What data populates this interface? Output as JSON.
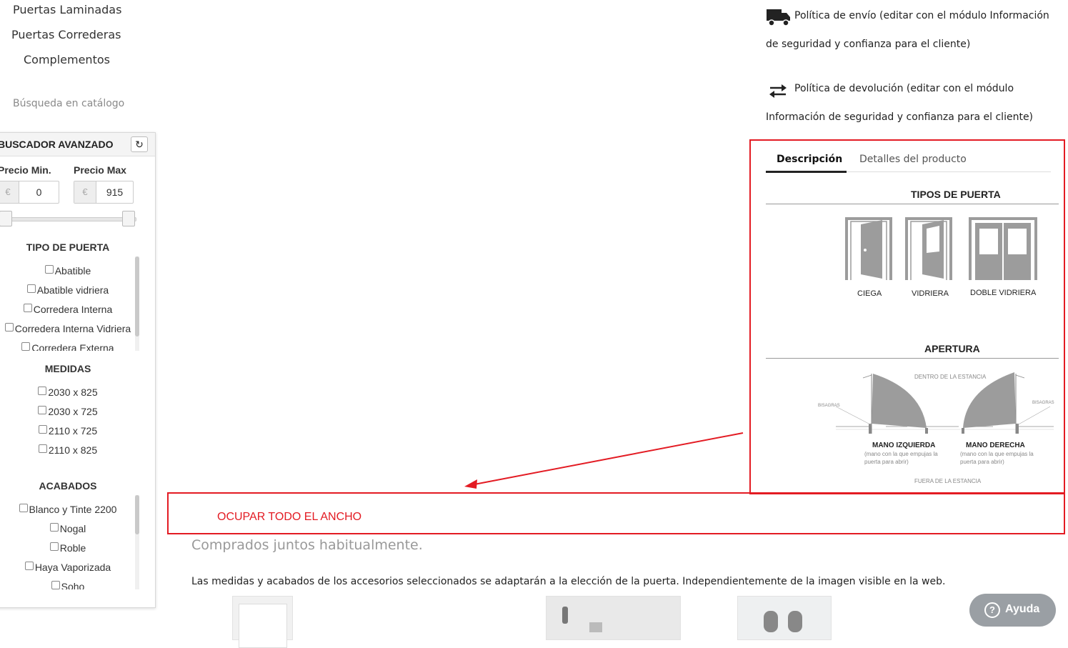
{
  "categories": [
    "Puertas Laminadas",
    "Puertas Correderas",
    "Complementos"
  ],
  "search": {
    "title": "Búsqueda en catálogo"
  },
  "advanced": {
    "title": "BUSCADOR AVANZADO",
    "refresh_icon": "refresh-icon",
    "price_min_label": "Precio Min.",
    "price_max_label": "Precio Max",
    "currency": "€",
    "price_min": "0",
    "price_max": "915",
    "sections": {
      "tipo": {
        "title": "TIPO DE PUERTA",
        "options": [
          "Abatible",
          "Abatible vidriera",
          "Corredera Interna",
          "Corredera Interna Vidriera",
          "Corredera Externa"
        ]
      },
      "medidas": {
        "title": "MEDIDAS",
        "options": [
          "2030 x 825",
          "2030 x 725",
          "2110 x 725",
          "2110 x 825"
        ]
      },
      "acabados": {
        "title": "ACABADOS",
        "options": [
          "Blanco y Tinte 2200",
          "Nogal",
          "Roble",
          "Haya Vaporizada",
          "Soho"
        ]
      }
    }
  },
  "policies": [
    {
      "icon": "truck-icon",
      "line1": "Política de envío (editar con el módulo Información",
      "line2": "de seguridad y confianza para el cliente)"
    },
    {
      "icon": "exchange-arrows-icon",
      "line1": "Política de devolución (editar con el módulo",
      "line2": "Información de seguridad y confianza para el cliente)"
    }
  ],
  "tabs": [
    {
      "label": "Descripción",
      "active": true
    },
    {
      "label": "Detalles del producto",
      "active": false
    }
  ],
  "description": {
    "tipos_title": "TIPOS DE PUERTA",
    "door_types": [
      "CIEGA",
      "VIDRIERA",
      "DOBLE VIDRIERA"
    ],
    "apertura_title": "APERTURA",
    "dentro": "DENTRO DE LA ESTANCIA",
    "fuera": "FUERA DE LA ESTANCIA",
    "bisagras": "BISAGRAS",
    "left_hand": "MANO IZQUIERDA",
    "right_hand": "MANO DERECHA",
    "hand_note_1": "(mano con la que empujas la",
    "hand_note_2": "puerta para abrir)"
  },
  "annotation": "OCUPAR TODO EL ANCHO",
  "annotation_color": "#e31b23",
  "bought_together": "Comprados juntos habitualmente.",
  "note": "Las medidas y acabados de los accesorios seleccionados se adaptarán a la elección de la puerta. Independientemente de la imagen visible en la web.",
  "help": {
    "label": "Ayuda",
    "icon": "question-circle-icon"
  }
}
